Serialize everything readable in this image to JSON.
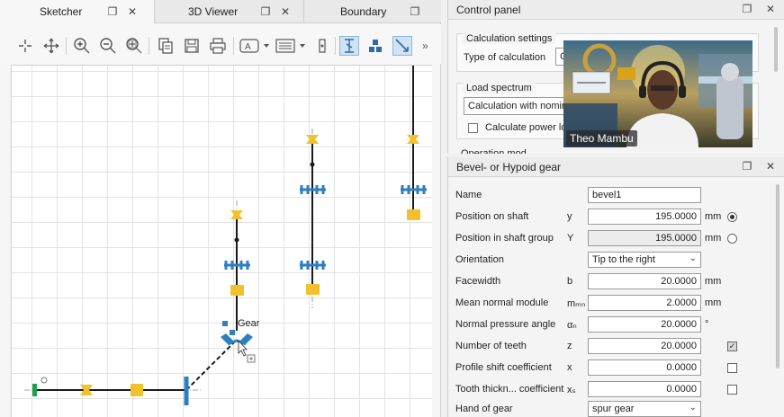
{
  "left_tabs": [
    {
      "label": "Sketcher"
    },
    {
      "label": "3D Viewer"
    },
    {
      "label": "Boundary"
    }
  ],
  "tab_icons": {
    "restore": "restore-window-icon",
    "close": "close-icon"
  },
  "toolbar_overflow": "»",
  "canvas": {
    "gear_label": "Gear"
  },
  "colors": {
    "shaft": "#1a1a1a",
    "bearing_yellow": "#f2c12e",
    "bearing_blue": "#2e7fc0",
    "coupling_green": "#1aa34a",
    "grid": "#e3e3e3"
  },
  "control_panel": {
    "title": "Control panel",
    "calc_settings": {
      "group_title": "Calculation settings",
      "type_label": "Type of calculation",
      "type_value": "C"
    },
    "load_spectrum": {
      "group_title": "Load spectrum",
      "combo_value": "Calculation with nominal",
      "power_loss_label": "Calculate power los"
    },
    "cutoff_label": "Operation mod"
  },
  "video": {
    "name": "Theo Mambu"
  },
  "bevel": {
    "title": "Bevel- or Hypoid gear",
    "rows": [
      {
        "name": "Name",
        "symbol": "",
        "value": "bevel1",
        "unit": ""
      },
      {
        "name": "Position on shaft",
        "symbol": "y",
        "value": "195.0000",
        "unit": "mm"
      },
      {
        "name": "Position in shaft group",
        "symbol": "Y",
        "value": "195.0000",
        "unit": "mm"
      },
      {
        "name": "Orientation",
        "symbol": "",
        "value": "Tip to the right",
        "unit": ""
      },
      {
        "name": "Facewidth",
        "symbol": "b",
        "value": "20.0000",
        "unit": "mm"
      },
      {
        "name": "Mean normal module",
        "symbol": "mₘₙ",
        "value": "2.0000",
        "unit": "mm"
      },
      {
        "name": "Normal pressure angle",
        "symbol": "αₙ",
        "value": "20.0000",
        "unit": "°"
      },
      {
        "name": "Number of teeth",
        "symbol": "z",
        "value": "20.0000",
        "unit": ""
      },
      {
        "name": "Profile shift coefficient",
        "symbol": "x",
        "value": "0.0000",
        "unit": ""
      },
      {
        "name": "Tooth thickn... coefficient",
        "symbol": "xₛ",
        "value": "0.0000",
        "unit": ""
      },
      {
        "name": "Hand of gear",
        "symbol": "",
        "value": "spur gear",
        "unit": ""
      }
    ]
  }
}
